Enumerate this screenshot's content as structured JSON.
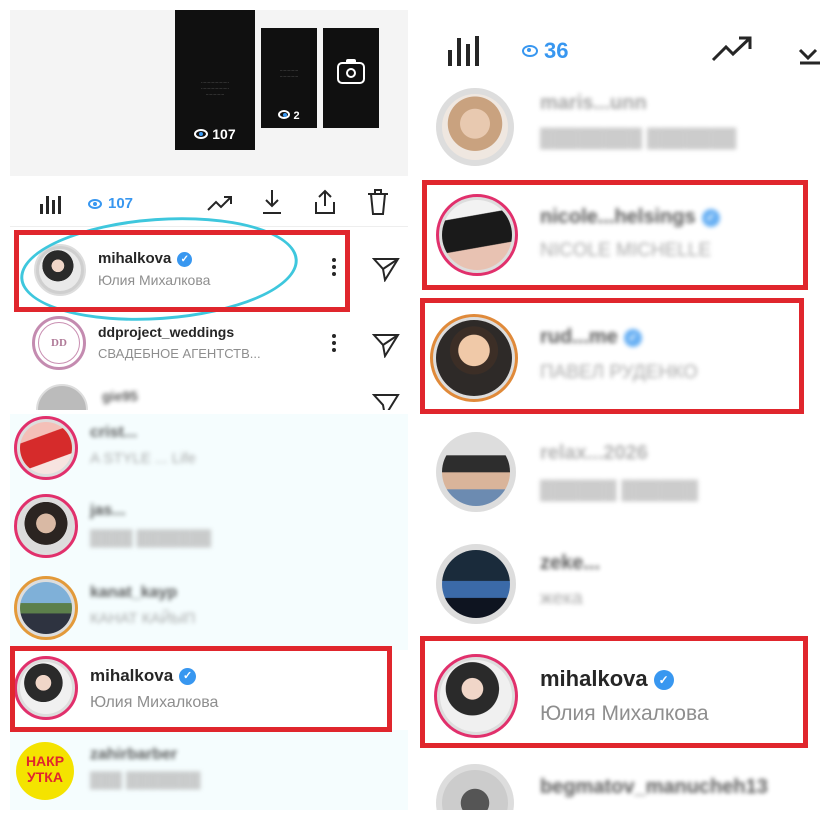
{
  "panel_left_top": {
    "stories": [
      {
        "views": "107"
      },
      {
        "views": "2"
      },
      {
        "type": "camera"
      }
    ],
    "toolbar": {
      "views": "107",
      "icons": [
        "bar-chart-icon",
        "trend-icon",
        "download-icon",
        "share-icon",
        "trash-icon"
      ]
    },
    "viewers": [
      {
        "username": "mihalkova",
        "fullname": "Юлия Михалкова",
        "verified": true
      },
      {
        "username": "ddproject_weddings",
        "fullname": "СВАДЕБНОЕ АГЕНТСТВ..."
      },
      {
        "username": "gie95",
        "fullname": ""
      }
    ]
  },
  "panel_left_bottom": {
    "viewers": [
      {
        "username": "crist...",
        "fullname": "A STYLE ... Life"
      },
      {
        "username": "jas...",
        "fullname": ""
      },
      {
        "username": "kanat_kayp",
        "fullname": "КАНАТ КАЙЫП"
      },
      {
        "username": "mihalkova",
        "fullname": "Юлия Михалкова",
        "verified": true
      },
      {
        "username": "zahirbarber",
        "fullname": "",
        "avatar_text": "НАКРУТКА"
      }
    ]
  },
  "panel_right": {
    "toolbar": {
      "views": "36"
    },
    "viewers": [
      {
        "username": "maris...unn",
        "fullname": ""
      },
      {
        "username": "nicole...helsings",
        "fullname": "NICOLE MICHELLE",
        "verified": true
      },
      {
        "username": "rud...me",
        "fullname": "ПАВЕЛ РУДЕНКО",
        "verified": true
      },
      {
        "username": "relax...2026",
        "fullname": ""
      },
      {
        "username": "zeke...",
        "fullname": "жека"
      },
      {
        "username": "mihalkova",
        "fullname": "Юлия Михалкова",
        "verified": true
      },
      {
        "username": "begmatov_manucheh13",
        "fullname": ""
      }
    ]
  },
  "colors": {
    "highlight_box": "#e0262d",
    "accent": "#3897f0",
    "story_ring": "#e1306c",
    "circle_mark": "#3ec7dd"
  }
}
